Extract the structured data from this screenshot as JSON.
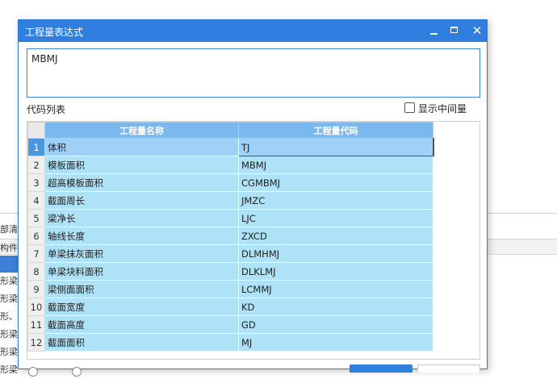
{
  "background": {
    "tab_text": "部清",
    "header_text": "构件",
    "rows": [
      "形梁",
      "形梁",
      "形、",
      "形梁",
      "形梁",
      "形梁"
    ]
  },
  "dialog": {
    "title": "工程量表达式",
    "minimize_icon": "minimize-icon",
    "maximize_icon": "maximize-icon",
    "close_icon": "close-icon",
    "close_glyph": "✕",
    "expression_value": "MBMJ",
    "code_list_label": "代码列表",
    "show_intermediate_label": "显示中间量",
    "show_intermediate_checked": false
  },
  "table": {
    "columns": [
      "工程量名称",
      "工程量代码"
    ],
    "selected_row": 1,
    "rows": [
      {
        "num": "1",
        "name": "体积",
        "code": "TJ"
      },
      {
        "num": "2",
        "name": "模板面积",
        "code": "MBMJ"
      },
      {
        "num": "3",
        "name": "超高模板面积",
        "code": "CGMBMJ"
      },
      {
        "num": "4",
        "name": "截面周长",
        "code": "JMZC"
      },
      {
        "num": "5",
        "name": "梁净长",
        "code": "LJC"
      },
      {
        "num": "6",
        "name": "轴线长度",
        "code": "ZXCD"
      },
      {
        "num": "7",
        "name": "单梁抹灰面积",
        "code": "DLMHMJ"
      },
      {
        "num": "8",
        "name": "单梁块料面积",
        "code": "DLKLMJ"
      },
      {
        "num": "9",
        "name": "梁侧面面积",
        "code": "LCMMJ"
      },
      {
        "num": "10",
        "name": "截面宽度",
        "code": "KD"
      },
      {
        "num": "11",
        "name": "截面高度",
        "code": "GD"
      },
      {
        "num": "12",
        "name": "截面面积",
        "code": "MJ"
      }
    ]
  },
  "colors": {
    "titlebar": "#2f7fdf",
    "header": "#7ab8ee",
    "cell": "#aee2f6",
    "selected_cell": "#9fd0f8"
  }
}
